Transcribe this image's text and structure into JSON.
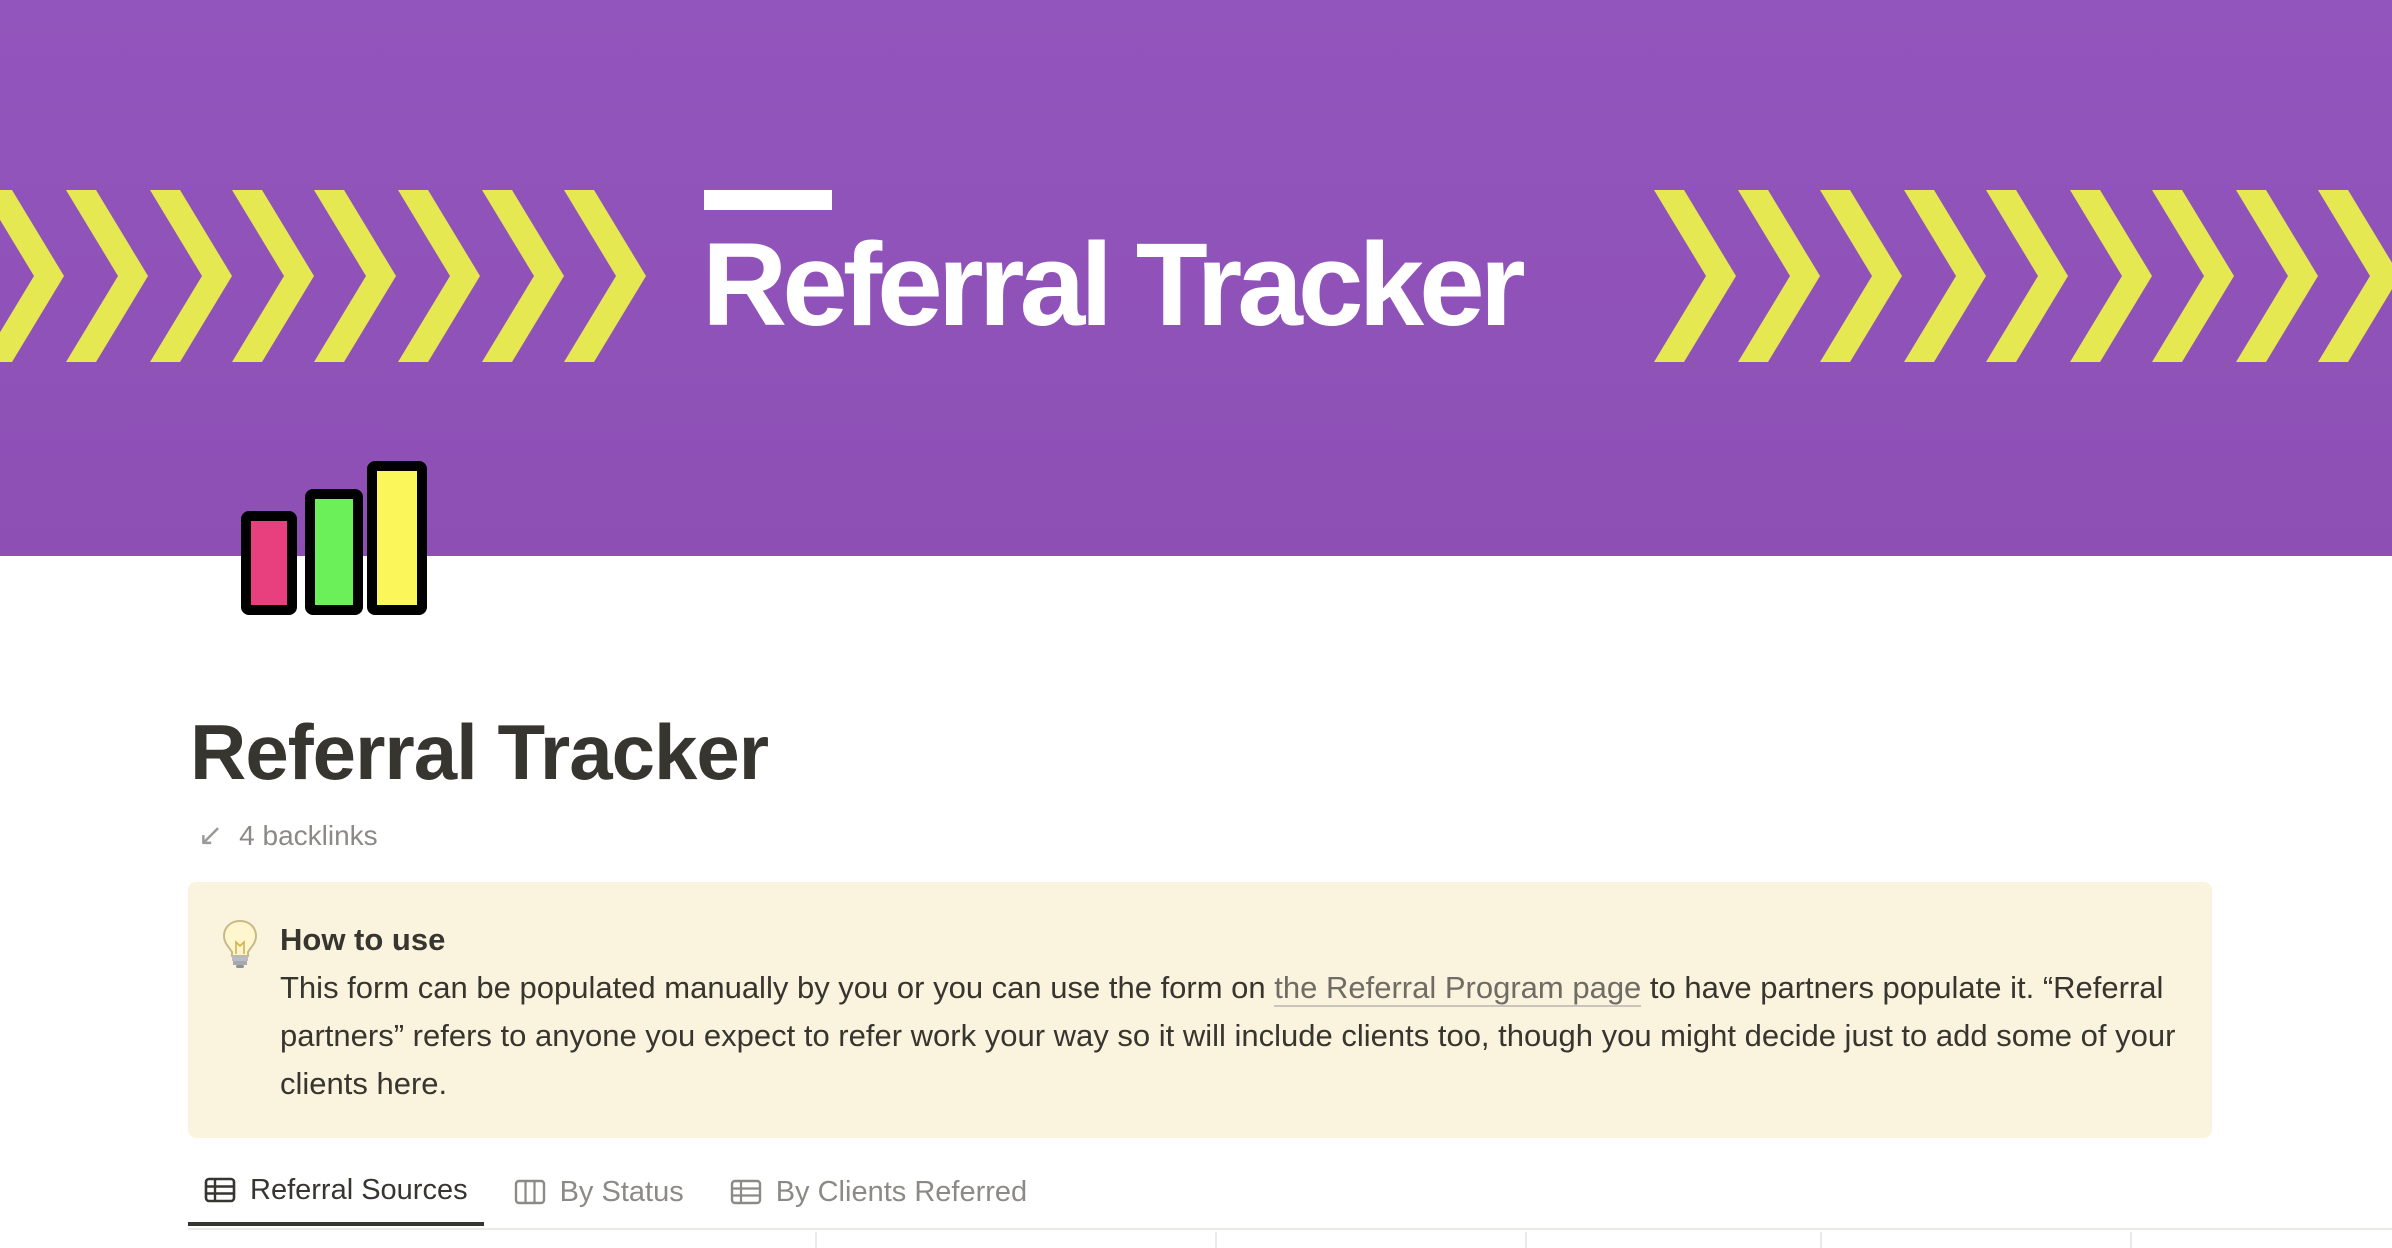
{
  "cover": {
    "title": "Referral Tracker",
    "colors": {
      "background": "#9255bd",
      "chevrons": "#e6e852",
      "title": "#ffffff"
    }
  },
  "page_icon": {
    "icon": "bar-chart-icon",
    "bar_colors": [
      "#e8407f",
      "#6cf05a",
      "#fbf65a"
    ]
  },
  "page": {
    "title": "Referral Tracker",
    "backlinks_label": "4 backlinks"
  },
  "callout": {
    "icon": "lightbulb-icon",
    "heading": "How to use",
    "text_before_link": "This form can be populated manually by you or you can use the form on ",
    "link_text": "the Referral Program page",
    "text_after_link": " to have partners populate it. “Referral partners” refers to anyone you expect to refer work your way so it will include clients too, though you might decide just to add some of your clients here.",
    "background": "#faf3dd"
  },
  "tabs": [
    {
      "label": "Referral Sources",
      "icon": "table-icon",
      "active": true
    },
    {
      "label": "By Status",
      "icon": "board-icon",
      "active": false
    },
    {
      "label": "By Clients Referred",
      "icon": "table-icon",
      "active": false
    }
  ]
}
